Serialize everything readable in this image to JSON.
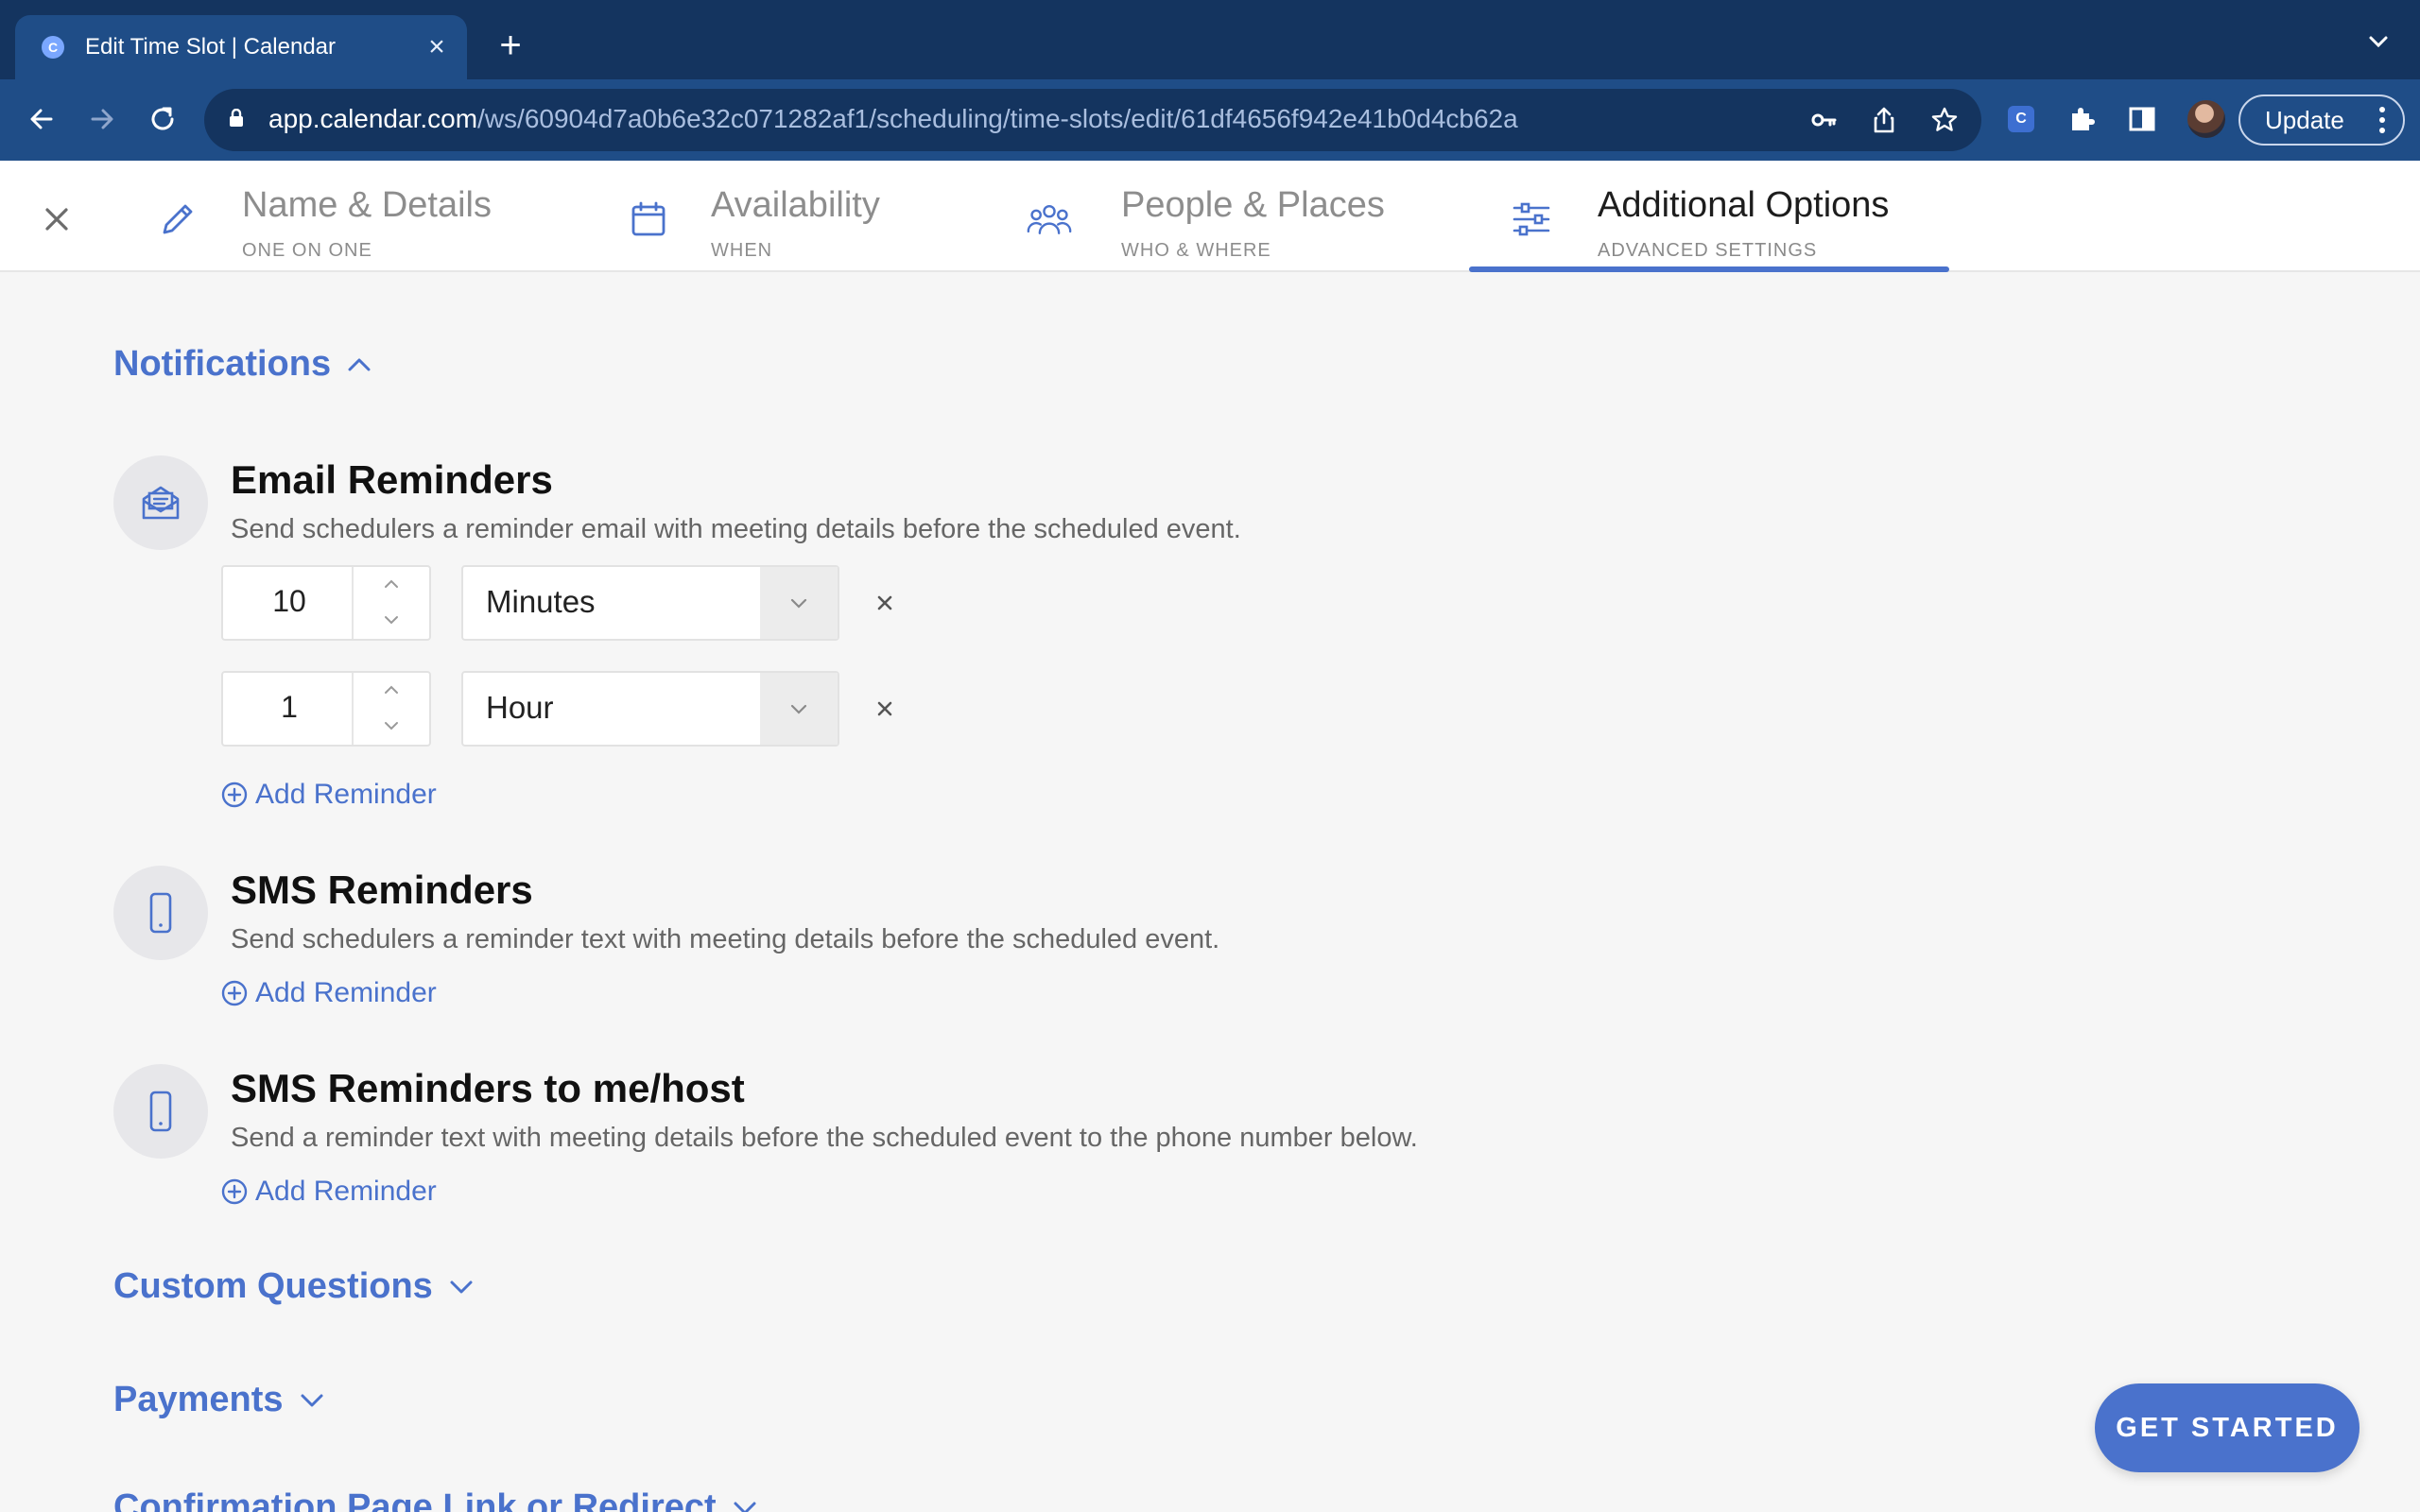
{
  "browser": {
    "tab_title": "Edit Time Slot | Calendar",
    "tab_favicon_letter": "C",
    "url_host": "app.calendar.com",
    "url_path": "/ws/60904d7a0b6e32c071282af1/scheduling/time-slots/edit/61df4656f942e41b0d4cb62a",
    "extension_letter": "C",
    "update_label": "Update"
  },
  "steps": [
    {
      "title": "Name & Details",
      "subtitle": "ONE ON ONE",
      "icon": "pencil-icon",
      "active": false
    },
    {
      "title": "Availability",
      "subtitle": "WHEN",
      "icon": "calendar-icon",
      "active": false
    },
    {
      "title": "People & Places",
      "subtitle": "WHO & WHERE",
      "icon": "people-icon",
      "active": false
    },
    {
      "title": "Additional Options",
      "subtitle": "ADVANCED SETTINGS",
      "icon": "sliders-icon",
      "active": true
    }
  ],
  "notifications": {
    "heading": "Notifications",
    "expanded": true,
    "email": {
      "title": "Email Reminders",
      "description": "Send schedulers a reminder email with meeting details before the scheduled event.",
      "reminders": [
        {
          "value": "10",
          "unit": "Minutes"
        },
        {
          "value": "1",
          "unit": "Hour"
        }
      ],
      "add_label": "Add Reminder"
    },
    "sms": {
      "title": "SMS Reminders",
      "description": "Send schedulers a reminder text with meeting details before the scheduled event.",
      "add_label": "Add Reminder"
    },
    "sms_host": {
      "title": "SMS Reminders to me/host",
      "description": "Send a reminder text with meeting details before the scheduled event to the phone number below.",
      "add_label": "Add Reminder"
    }
  },
  "sections": {
    "custom_questions": "Custom Questions",
    "payments": "Payments",
    "confirmation": "Confirmation Page Link or Redirect"
  },
  "cta": {
    "label": "GET STARTED"
  },
  "colors": {
    "accent": "#4a72cc",
    "chrome_dark": "#14345f",
    "chrome": "#1f4d87"
  }
}
